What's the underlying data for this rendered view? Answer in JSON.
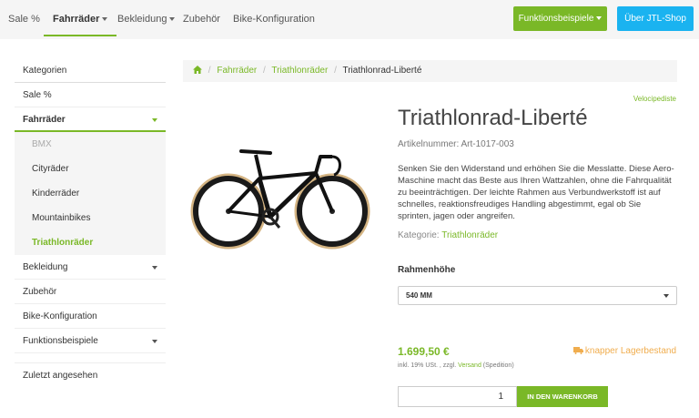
{
  "nav": {
    "items": [
      {
        "label": "Sale %"
      },
      {
        "label": "Fahrräder"
      },
      {
        "label": "Bekleidung"
      },
      {
        "label": "Zubehör"
      },
      {
        "label": "Bike-Konfiguration"
      }
    ],
    "btn_examples": "Funktionsbeispiele",
    "btn_about": "Über JTL-Shop"
  },
  "sidebar": {
    "heading": "Kategorien",
    "items": [
      {
        "label": "Sale %"
      },
      {
        "label": "Fahrräder"
      },
      {
        "label": "Bekleidung"
      },
      {
        "label": "Zubehör"
      },
      {
        "label": "Bike-Konfiguration"
      },
      {
        "label": "Funktionsbeispiele"
      }
    ],
    "subitems": [
      {
        "label": "BMX"
      },
      {
        "label": "Cityräder"
      },
      {
        "label": "Kinderräder"
      },
      {
        "label": "Mountainbikes"
      },
      {
        "label": "Triathlonräder"
      }
    ],
    "recent": "Zuletzt angesehen"
  },
  "breadcrumb": {
    "items": [
      "Fahrräder",
      "Triathlonräder"
    ],
    "current": "Triathlonrad-Liberté",
    "separator": "/"
  },
  "product": {
    "manufacturer": "Velocipediste",
    "title": "Triathlonrad-Liberté",
    "article_number": "Artikelnummer: Art-1017-003",
    "description": "Senken Sie den Widerstand und erhöhen Sie die Messlatte. Diese Aero-Maschine macht das Beste aus Ihren Wattzahlen, ohne die Fahrqualität zu beeinträchtigen. Der leichte Rahmen aus Verbundwerkstoff ist auf schnelles, reaktionsfreudiges Handling abgestimmt, egal ob Sie sprinten, jagen oder angreifen.",
    "category_label": "Kategorie:",
    "category_value": "Triathlonräder",
    "variation_label": "Rahmenhöhe",
    "variation_selected": "540 MM",
    "price": "1.699,50 €",
    "stock": "knapper Lagerbestand",
    "vat_pre": "inkl. 19% USt. , zzgl.",
    "vat_link": "Versand",
    "vat_post": "(Spedition)",
    "quantity": "1",
    "cart_button": "IN DEN WARENKORB"
  },
  "colors": {
    "accent": "#7ab827",
    "blue": "#1ab3f0",
    "stock": "#f0ad4e"
  }
}
